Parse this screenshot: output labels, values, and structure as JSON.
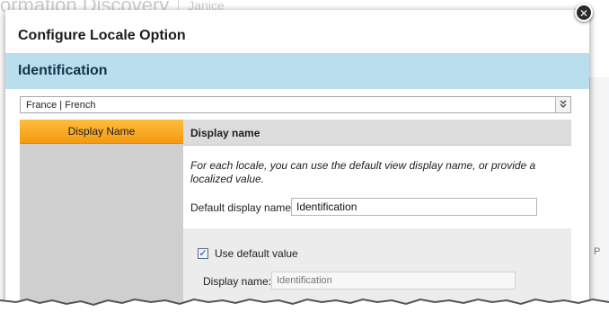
{
  "background": {
    "app_title": "ormation Discovery",
    "user_name": "Janice",
    "right_stub": "P"
  },
  "dialog": {
    "title": "Configure Locale Option",
    "close_icon": "close-icon",
    "section_title": "Identification",
    "locale_select": {
      "value": "France | French",
      "icon": "double-chevron-down-icon"
    },
    "left_panel": {
      "items": [
        {
          "label": "Display Name",
          "selected": true
        }
      ]
    },
    "right_panel": {
      "header": "Display name",
      "description": "For each locale, you can use the default view display name, or provide a localized value.",
      "default_display_name_label": "Default display name:",
      "default_display_name_value": "Identification",
      "use_default_checkbox": {
        "label": "Use default value",
        "checked": true
      },
      "display_name_label": "Display name:",
      "display_name_placeholder": "Identification"
    }
  },
  "colors": {
    "section_band": "#b9dfee",
    "selected_item": "#f8a722",
    "left_panel_bg": "#cfcfcf",
    "header_bg": "#dcdcdc"
  }
}
